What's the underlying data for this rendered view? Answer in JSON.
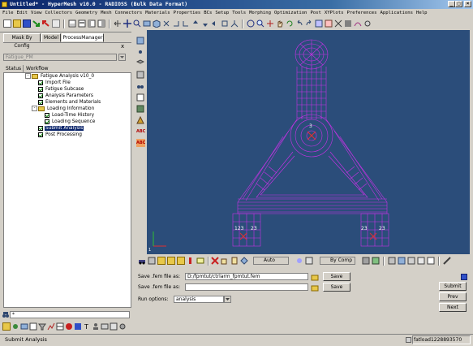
{
  "window": {
    "title": "Untitled* - HyperMesh v10.0 - RADIOSS (Bulk Data Format)"
  },
  "menu": [
    "File",
    "Edit",
    "View",
    "Collectors",
    "Geometry",
    "Mesh",
    "Connectors",
    "Materials",
    "Properties",
    "BCs",
    "Setup",
    "Tools",
    "Morphing",
    "Optimization",
    "Post",
    "XYPlots",
    "Preferences",
    "Applications",
    "Help"
  ],
  "left_tabs": [
    "Mask By Config",
    "Model",
    "ProcessManager"
  ],
  "process_combo": "Fatigue_PM",
  "tree_header": [
    "Status",
    "Workflow"
  ],
  "tree": [
    {
      "label": "Fatigue Analysis v10_0",
      "type": "folder"
    },
    {
      "label": "Import File",
      "type": "check"
    },
    {
      "label": "Fatigue Subcase",
      "type": "check"
    },
    {
      "label": "Analysis Parameters",
      "type": "check"
    },
    {
      "label": "Elements and Materials",
      "type": "check"
    },
    {
      "label": "Loading Information",
      "type": "folder"
    },
    {
      "label": "Load-Time History",
      "type": "check"
    },
    {
      "label": "Loading Sequence",
      "type": "check"
    },
    {
      "label": "Submit Analysis",
      "type": "check",
      "selected": true
    },
    {
      "label": "Post Processing",
      "type": "check"
    }
  ],
  "command_line": "*",
  "viewport": {
    "labels": [
      "3",
      "123",
      "23",
      "23",
      "23",
      "1"
    ],
    "colors": {
      "background": "#2b4d7a",
      "mesh": "#c832e6"
    }
  },
  "toolbar_bottom": {
    "auto_label": "Auto",
    "bycomp_label": "By Comp"
  },
  "form": {
    "save_fem_label": "Save .fem file as:",
    "save_fem_value": "D:/fpmtut/ctrlarm_fpmtut.fem",
    "save_fem_as_label": "Save .fem file as:",
    "save_fem_as_value": "",
    "run_options_label": "Run options:",
    "run_options_value": "analysis",
    "save_button": "Save",
    "save_button2": "Save",
    "submit_button": "Submit",
    "prev_button": "Prev",
    "next_button": "Next"
  },
  "status": {
    "left": "Submit Analysis",
    "right": "fatload1228893570"
  }
}
